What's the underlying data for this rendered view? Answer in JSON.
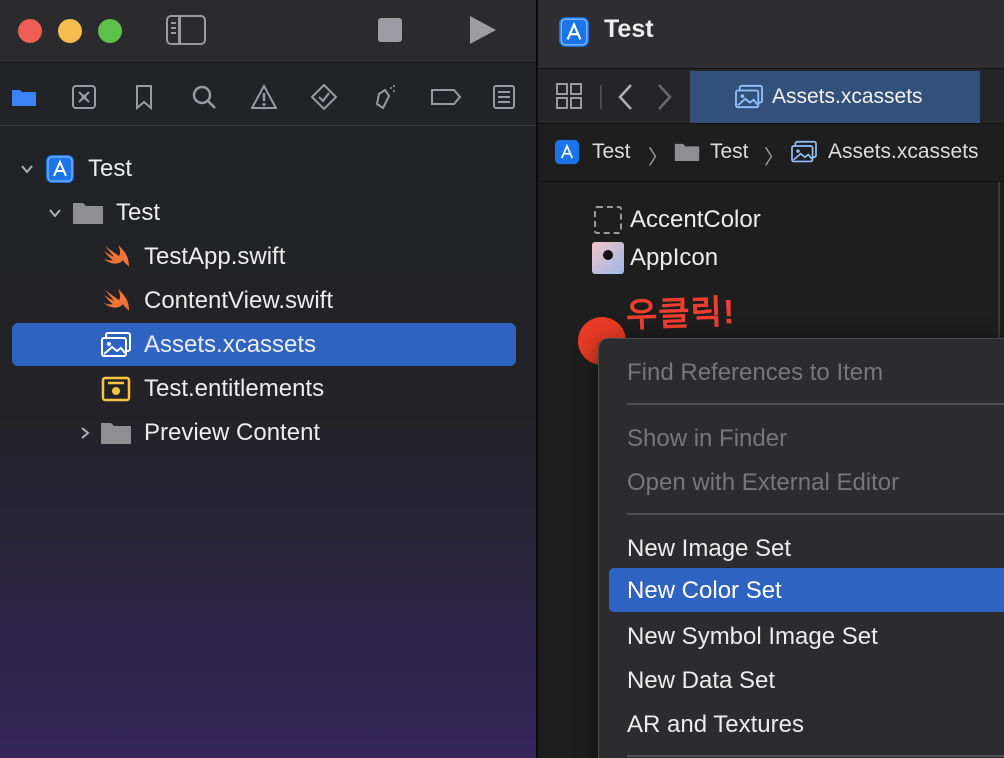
{
  "window": {
    "traffic_lights": [
      "close",
      "minimize",
      "zoom"
    ],
    "project_title": "Test"
  },
  "navigator": {
    "tabs": [
      "folder-icon",
      "source-control-icon",
      "bookmark-icon",
      "search-icon",
      "warning-icon",
      "test-icon",
      "debug-icon",
      "breakpoint-icon",
      "report-icon"
    ],
    "tree": [
      {
        "label": "Test",
        "kind": "project",
        "expanded": true
      },
      {
        "label": "Test",
        "kind": "folder",
        "expanded": true
      },
      {
        "label": "TestApp.swift",
        "kind": "swift"
      },
      {
        "label": "ContentView.swift",
        "kind": "swift"
      },
      {
        "label": "Assets.xcassets",
        "kind": "assets",
        "selected": true
      },
      {
        "label": "Test.entitlements",
        "kind": "entitlements"
      },
      {
        "label": "Preview Content",
        "kind": "folder",
        "expanded": false
      }
    ]
  },
  "editor": {
    "tab_title": "Assets.xcassets",
    "breadcrumb": [
      "Test",
      "Test",
      "Assets.xcassets"
    ],
    "assets": [
      {
        "name": "AccentColor"
      },
      {
        "name": "AppIcon"
      }
    ],
    "annotation": "우클릭!"
  },
  "context_menu": {
    "items": [
      {
        "label": "Find References to Item",
        "state": "disabled"
      },
      {
        "separator": true
      },
      {
        "label": "Show in Finder",
        "state": "disabled"
      },
      {
        "label": "Open with External Editor",
        "state": "disabled"
      },
      {
        "separator": true
      },
      {
        "label": "New Image Set",
        "state": "enabled"
      },
      {
        "label": "New Color Set",
        "state": "highlighted"
      },
      {
        "label": "New Symbol Image Set",
        "state": "enabled"
      },
      {
        "label": "New Data Set",
        "state": "enabled"
      },
      {
        "label": "AR and Textures",
        "state": "enabled"
      }
    ]
  },
  "colors": {
    "selection": "#2f63c2",
    "annotation_red": "#ef3e2f",
    "swift_orange": "#f0733a"
  }
}
